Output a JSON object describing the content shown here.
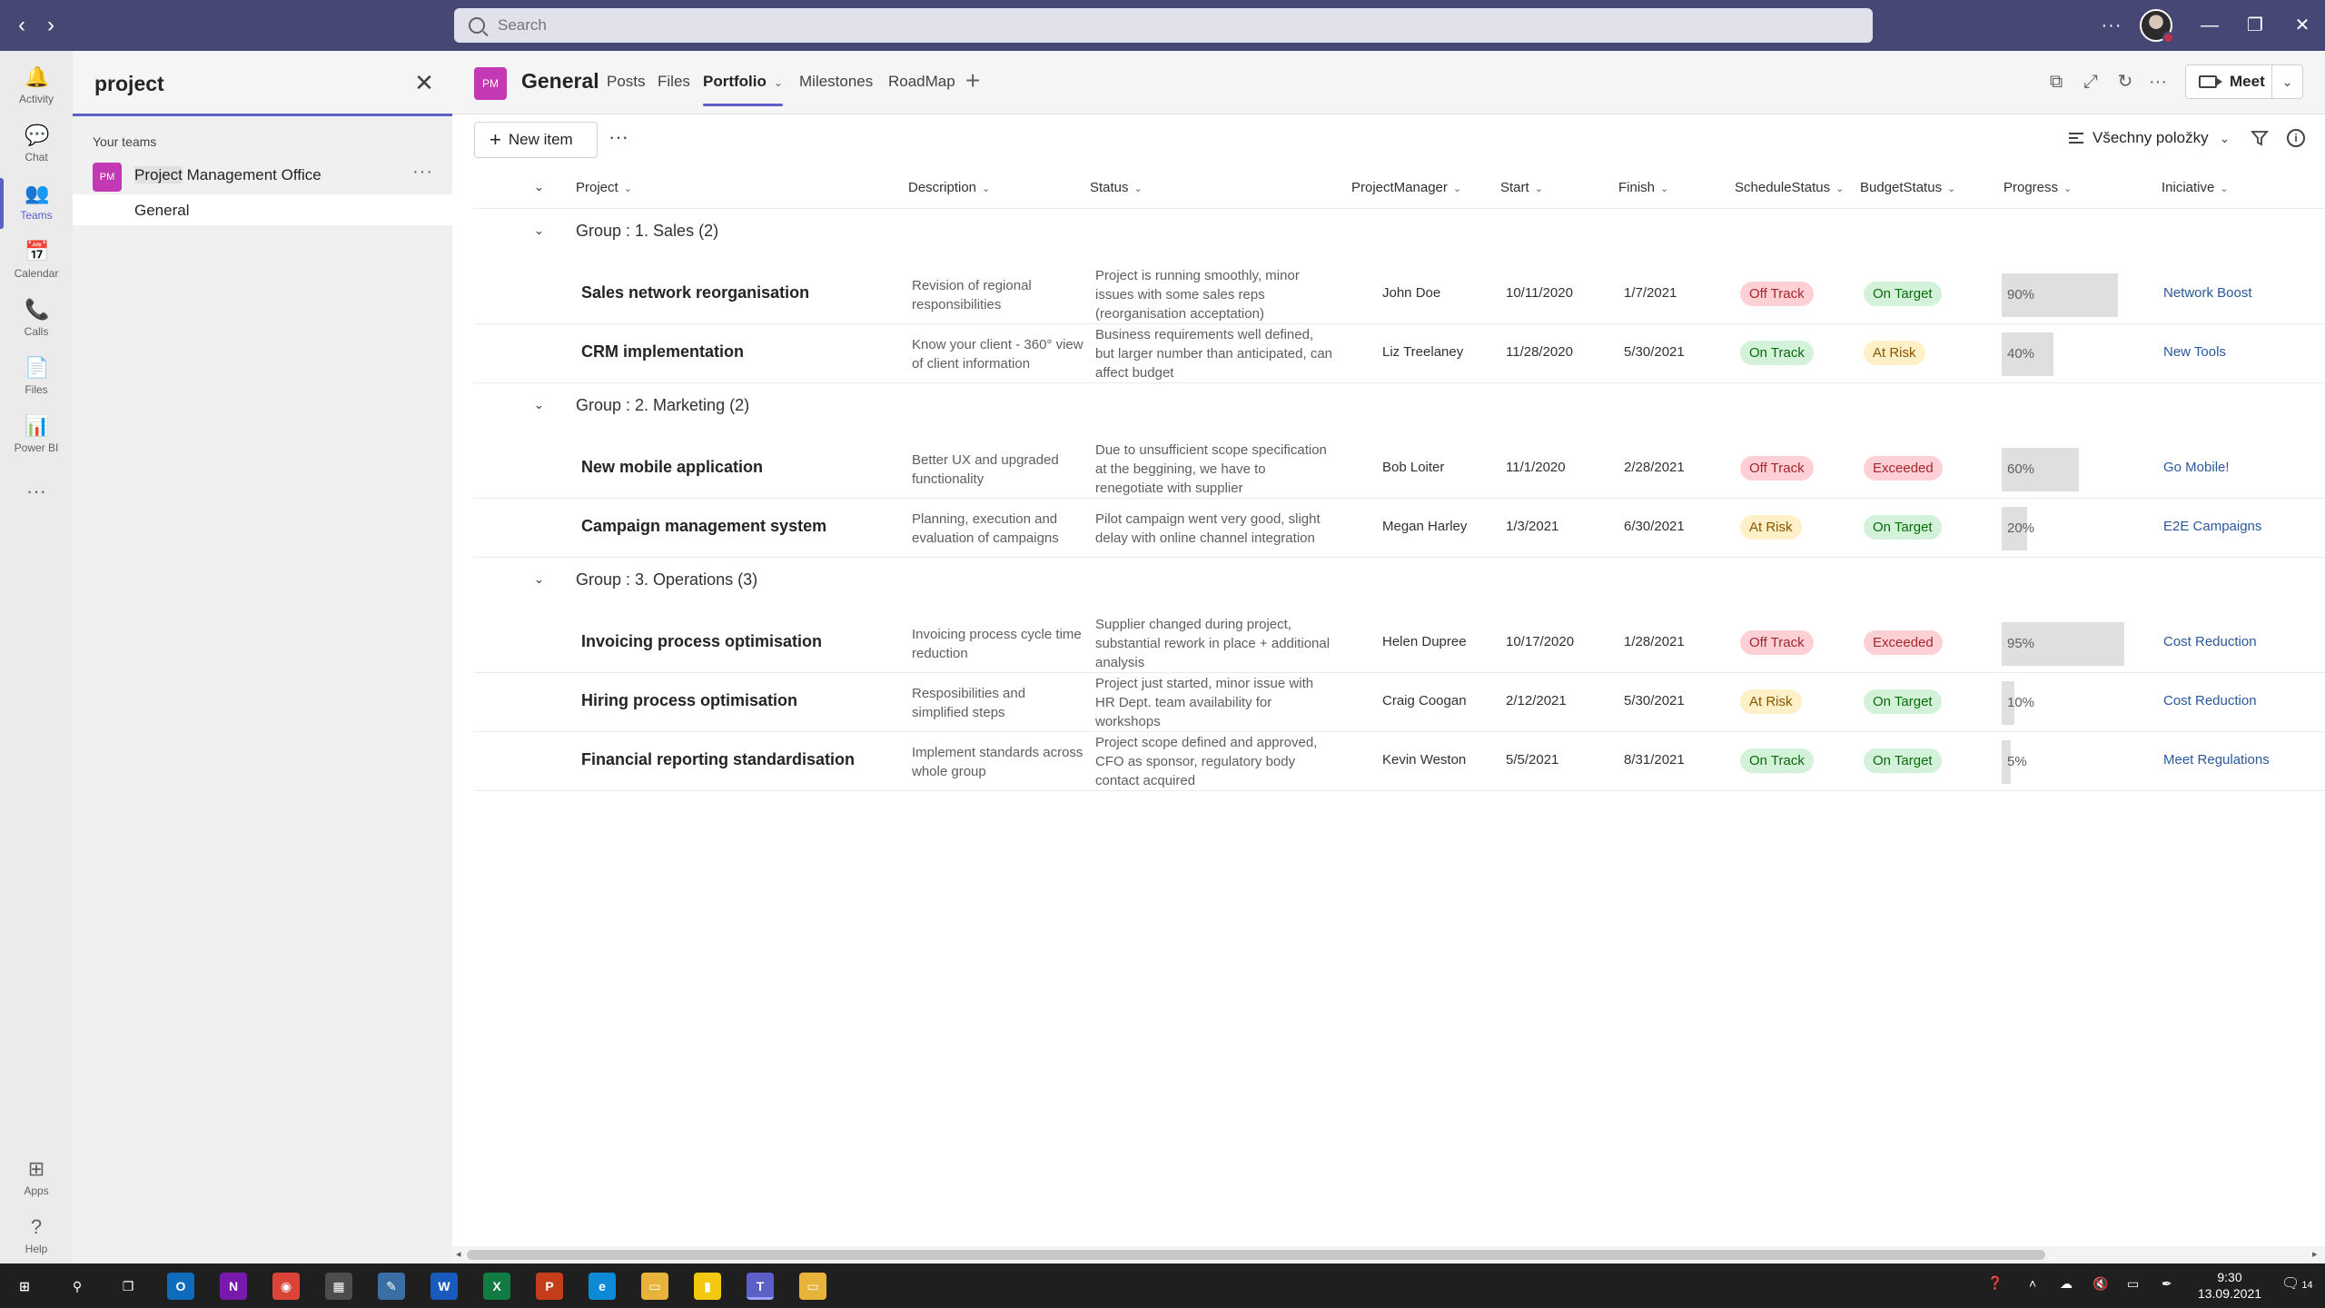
{
  "titlebar": {
    "search_placeholder": "Search",
    "more": "···"
  },
  "rail": [
    {
      "label": "Activity",
      "icon": "bell-icon",
      "glyph": "🔔"
    },
    {
      "label": "Chat",
      "icon": "chat-icon",
      "glyph": "💬"
    },
    {
      "label": "Teams",
      "icon": "teams-icon",
      "glyph": "👥"
    },
    {
      "label": "Calendar",
      "icon": "calendar-icon",
      "glyph": "📅"
    },
    {
      "label": "Calls",
      "icon": "phone-icon",
      "glyph": "📞"
    },
    {
      "label": "Files",
      "icon": "file-icon",
      "glyph": "📄"
    },
    {
      "label": "Power BI",
      "icon": "powerbi-icon",
      "glyph": "📊"
    }
  ],
  "rail_more": "···",
  "rail_bottom": [
    {
      "label": "Apps",
      "icon": "apps-icon",
      "glyph": "⊞"
    },
    {
      "label": "Help",
      "icon": "help-icon",
      "glyph": "?"
    }
  ],
  "leftpanel": {
    "search_value": "project",
    "section_label": "Your teams",
    "team": {
      "avatar": "PM",
      "name_highlight": "Project",
      "name_rest": " Management Office"
    },
    "channel": "General"
  },
  "header": {
    "avatar": "PM",
    "title": "General",
    "tabs": [
      {
        "label": "Posts",
        "active": false
      },
      {
        "label": "Files",
        "active": false
      },
      {
        "label": "Portfolio",
        "active": true
      },
      {
        "label": "Milestones",
        "active": false
      },
      {
        "label": "RoadMap",
        "active": false
      }
    ],
    "meet_label": "Meet"
  },
  "toolbar": {
    "new_item": "New item",
    "view_label": "Všechny položky"
  },
  "columns": {
    "project": "Project",
    "description": "Description",
    "status": "Status",
    "pm": "ProjectManager",
    "start": "Start",
    "finish": "Finish",
    "schedule": "ScheduleStatus",
    "budget": "BudgetStatus",
    "progress": "Progress",
    "initiative": "Iniciative"
  },
  "status_colors": {
    "Off Track": {
      "bg": "#fdd0d6",
      "fg": "#a4262c"
    },
    "On Track": {
      "bg": "#d3f2d9",
      "fg": "#0b6a0b"
    },
    "At Risk": {
      "bg": "#fff1c7",
      "fg": "#8a5300"
    },
    "On Target": {
      "bg": "#d3f2d9",
      "fg": "#0b6a0b"
    },
    "Exceeded": {
      "bg": "#fdd0d6",
      "fg": "#a4262c"
    }
  },
  "groups": [
    {
      "title": "Group : 1. Sales (2)",
      "rows": [
        {
          "project": "Sales network reorganisation",
          "description": "Revision of regional responsibilities",
          "status": "Project is running smoothly, minor issues with some sales reps (reorganisation acceptation)",
          "pm": "John Doe",
          "start": "10/11/2020",
          "finish": "1/7/2021",
          "schedule": "Off Track",
          "budget": "On Target",
          "progress": 90,
          "progress_label": "90%",
          "initiative": "Network Boost"
        },
        {
          "project": "CRM implementation",
          "description": "Know your client - 360° view of client information",
          "status": "Business requirements well defined, but larger number than anticipated, can affect budget",
          "pm": "Liz Treelaney",
          "start": "11/28/2020",
          "finish": "5/30/2021",
          "schedule": "On Track",
          "budget": "At Risk",
          "progress": 40,
          "progress_label": "40%",
          "initiative": "New Tools"
        }
      ]
    },
    {
      "title": "Group : 2. Marketing (2)",
      "rows": [
        {
          "project": "New mobile application",
          "description": "Better UX and upgraded functionality",
          "status": "Due to unsufficient scope specification at the beggining, we have to renegotiate with supplier",
          "pm": "Bob Loiter",
          "start": "11/1/2020",
          "finish": "2/28/2021",
          "schedule": "Off Track",
          "budget": "Exceeded",
          "progress": 60,
          "progress_label": "60%",
          "initiative": "Go Mobile!"
        },
        {
          "project": "Campaign management system",
          "description": "Planning, execution and evaluation of campaigns",
          "status": "Pilot campaign went very good, slight delay with online channel integration",
          "pm": "Megan Harley",
          "start": "1/3/2021",
          "finish": "6/30/2021",
          "schedule": "At Risk",
          "budget": "On Target",
          "progress": 20,
          "progress_label": "20%",
          "initiative": "E2E Campaigns"
        }
      ]
    },
    {
      "title": "Group : 3. Operations (3)",
      "rows": [
        {
          "project": "Invoicing process optimisation",
          "description": "Invoicing process cycle time reduction",
          "status": "Supplier changed during project, substantial rework in place + additional analysis",
          "pm": "Helen Dupree",
          "start": "10/17/2020",
          "finish": "1/28/2021",
          "schedule": "Off Track",
          "budget": "Exceeded",
          "progress": 95,
          "progress_label": "95%",
          "initiative": "Cost Reduction"
        },
        {
          "project": "Hiring process optimisation",
          "description": "Resposibilities and simplified steps",
          "status": "Project just started, minor issue with HR Dept. team availability for workshops",
          "pm": "Craig Coogan",
          "start": "2/12/2021",
          "finish": "5/30/2021",
          "schedule": "At Risk",
          "budget": "On Target",
          "progress": 10,
          "progress_label": "10%",
          "initiative": "Cost Reduction"
        },
        {
          "project": "Financial reporting standardisation",
          "description": "Implement standards across whole group",
          "status": "Project scope defined and approved, CFO as sponsor, regulatory body contact acquired",
          "pm": "Kevin Weston",
          "start": "5/5/2021",
          "finish": "8/31/2021",
          "schedule": "On Track",
          "budget": "On Target",
          "progress": 5,
          "progress_label": "5%",
          "initiative": "Meet Regulations"
        }
      ]
    }
  ],
  "taskbar": {
    "apps": [
      {
        "name": "start",
        "glyph": "⊞",
        "color": "#1f1f1f"
      },
      {
        "name": "search",
        "glyph": "⚲",
        "color": "#1f1f1f"
      },
      {
        "name": "taskview",
        "glyph": "❐",
        "color": "#1f1f1f"
      },
      {
        "name": "outlook",
        "glyph": "O",
        "color": "#0f6cbd"
      },
      {
        "name": "onenote",
        "glyph": "N",
        "color": "#7719aa"
      },
      {
        "name": "chrome",
        "glyph": "◉",
        "color": "#db4437"
      },
      {
        "name": "calculator",
        "glyph": "▦",
        "color": "#4c4c4c"
      },
      {
        "name": "notepad",
        "glyph": "✎",
        "color": "#3a6ea5"
      },
      {
        "name": "word",
        "glyph": "W",
        "color": "#185abd"
      },
      {
        "name": "excel",
        "glyph": "X",
        "color": "#107c41"
      },
      {
        "name": "powerpoint",
        "glyph": "P",
        "color": "#c43e1c"
      },
      {
        "name": "edge",
        "glyph": "e",
        "color": "#0c8ad6"
      },
      {
        "name": "explorer",
        "glyph": "▭",
        "color": "#e8b33a"
      },
      {
        "name": "powerbi",
        "glyph": "▮",
        "color": "#f2c811"
      },
      {
        "name": "teams",
        "glyph": "T",
        "color": "#5b5fc7"
      },
      {
        "name": "explorer2",
        "glyph": "▭",
        "color": "#e8b33a"
      }
    ],
    "time": "9:30",
    "date": "13.09.2021",
    "notifications": "14"
  }
}
